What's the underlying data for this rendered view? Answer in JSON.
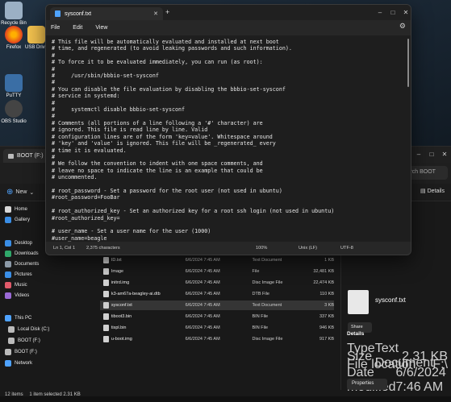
{
  "colors": {
    "accent": "#4fa3ff",
    "background": "#1e1e1e",
    "text": "#e6e6e6"
  },
  "desktop": {
    "icons": [
      {
        "label": "Recycle Bin",
        "icon": "recycle-bin-icon"
      },
      {
        "label": "Firefox",
        "icon": "firefox-icon"
      },
      {
        "label": "USB Drive",
        "icon": "folder-icon"
      },
      {
        "label": "PuTTY",
        "icon": "putty-icon"
      },
      {
        "label": "OBS Studio",
        "icon": "obs-icon"
      }
    ]
  },
  "notepad": {
    "tab_title": "sysconf.txt",
    "new_tab_symbol": "+",
    "menu": {
      "file": "File",
      "edit": "Edit",
      "view": "View"
    },
    "content": "# This file will be automatically evaluated and installed at next boot\n# time, and regenerated (to avoid leaking passwords and such information).\n#\n# To force it to be evaluated immediately, you can run (as root):\n#\n#     /usr/sbin/bbbio-set-sysconf\n#\n# You can disable the file evaluation by disabling the bbbio-set-sysconf\n# service in systemd:\n#\n#     systemctl disable bbbio-set-sysconf\n#\n# Comments (all portions of a line following a '#' character) are\n# ignored. This file is read line by line. Valid\n# configuration lines are of the form 'key=value'. Whitespace around\n# 'key' and 'value' is ignored. This file will be _regenerated_ every\n# time it is evaluated.\n#\n# We follow the convention to indent with one space comments, and\n# leave no space to indicate the line is an example that could be\n# uncommented.\n\n# root_password - Set a password for the root user (not used in ubuntu)\n#root_password=FooBar\n\n# root_authorized_key - Set an authorized key for a root ssh login (not used in ubuntu)\n#root_authorized_key=\n\n# user_name - Set a user name for the user (1000)\n#user_name=beagle",
    "status": {
      "position": "Ln 1, Col 1",
      "characters": "2,375 characters",
      "zoom": "100%",
      "line_ending": "Unix (LF)",
      "encoding": "UTF-8"
    }
  },
  "explorer": {
    "tab_title": "BOOT (F:)",
    "search_placeholder": "Search BOOT (F:)",
    "new_label": "New",
    "details_label": "Details",
    "nav": [
      {
        "label": "Home",
        "icon": "home-icon"
      },
      {
        "label": "Gallery",
        "icon": "gallery-icon"
      },
      {
        "label": "Desktop",
        "icon": "desktop-icon"
      },
      {
        "label": "Downloads",
        "icon": "downloads-icon"
      },
      {
        "label": "Documents",
        "icon": "documents-icon"
      },
      {
        "label": "Pictures",
        "icon": "pictures-icon"
      },
      {
        "label": "Music",
        "icon": "music-icon"
      },
      {
        "label": "Videos",
        "icon": "videos-icon"
      },
      {
        "label": "This PC",
        "icon": "pc-icon"
      },
      {
        "label": "Local Disk (C:)",
        "icon": "disk-icon"
      },
      {
        "label": "BOOT (F:)",
        "icon": "usb-drive-icon"
      },
      {
        "label": "BOOT (F:)",
        "icon": "usb-drive-icon"
      },
      {
        "label": "Network",
        "icon": "network-icon"
      }
    ],
    "files": [
      {
        "name": "ID.txt",
        "date": "6/6/2024 7:45 AM",
        "type": "Text Document",
        "size": "1 KB"
      },
      {
        "name": "Image",
        "date": "6/6/2024 7:45 AM",
        "type": "File",
        "size": "32,481 KB"
      },
      {
        "name": "initrd.img",
        "date": "6/6/2024 7:45 AM",
        "type": "Disc Image File",
        "size": "22,474 KB"
      },
      {
        "name": "k3-am67a-beagley-ai.dtb",
        "date": "6/6/2024 7:45 AM",
        "type": "DTB File",
        "size": "110 KB"
      },
      {
        "name": "sysconf.txt",
        "date": "6/6/2024 7:45 AM",
        "type": "Text Document",
        "size": "3 KB"
      },
      {
        "name": "tiboot3.bin",
        "date": "6/6/2024 7:45 AM",
        "type": "BIN File",
        "size": "337 KB"
      },
      {
        "name": "tispl.bin",
        "date": "6/6/2024 7:45 AM",
        "type": "BIN File",
        "size": "946 KB"
      },
      {
        "name": "u-boot.img",
        "date": "6/6/2024 7:45 AM",
        "type": "Disc Image File",
        "size": "917 KB"
      }
    ],
    "detail": {
      "name": "sysconf.txt",
      "share": "Share",
      "heading": "Details",
      "rows": [
        {
          "k": "Type",
          "v": "Text Document"
        },
        {
          "k": "Size",
          "v": "2.31 KB"
        },
        {
          "k": "File location",
          "v": "F:\\"
        },
        {
          "k": "Date modified",
          "v": "6/6/2024 7:46 AM"
        }
      ],
      "properties": "Properties"
    },
    "status": {
      "items": "12 items",
      "selected": "1 item selected  2.31 KB"
    }
  }
}
